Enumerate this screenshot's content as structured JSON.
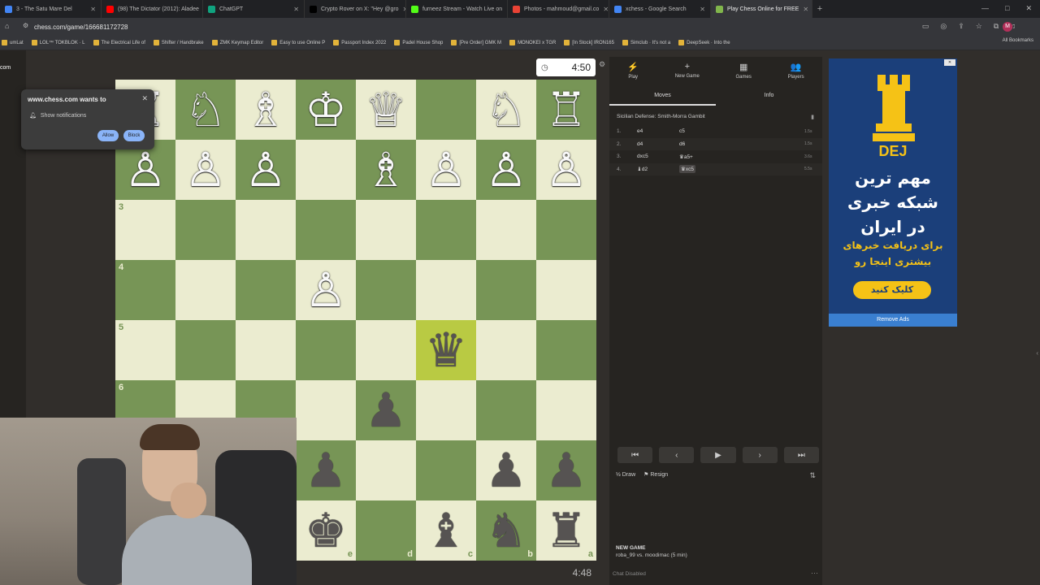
{
  "browser": {
    "tabs": [
      {
        "title": "3 - The Satu Mare Del",
        "color": "#4285f4",
        "active": false
      },
      {
        "title": "(98) The Dictator (2012): Aladee",
        "color": "#ff0000",
        "active": false
      },
      {
        "title": "ChatGPT",
        "color": "#10a37f",
        "active": false
      },
      {
        "title": "Crypto Rover on X: \"Hey @gro",
        "color": "#000000",
        "active": false
      },
      {
        "title": "furneez Stream - Watch Live on",
        "color": "#53fc18",
        "active": false
      },
      {
        "title": "Photos - mahmoud@gmail.co",
        "color": "#ea4335",
        "active": false
      },
      {
        "title": "xchess - Google Search",
        "color": "#4285f4",
        "active": false
      },
      {
        "title": "Play Chess Online for FREE",
        "color": "#81b64c",
        "active": true
      }
    ],
    "new_tab": "+",
    "url": "chess.com/game/166681172728",
    "avatar_letter": "M",
    "bookmarks": [
      "umLat",
      "LOL™ TOKBLOK · L",
      "The Electrical Life of",
      "Shifter / Handbrake",
      "ZMK Keymap Editor",
      "Easy to use Online P",
      "Passport Index 2022",
      "Padel House Shop",
      "[Pre Order] GMK M",
      "MONOKEI x TGR",
      "[In Stock] IRON165",
      "Simclub · It's not a",
      "DeepSeek · Into the"
    ],
    "all_bookmarks": "All Bookmarks"
  },
  "notification": {
    "title": "www.chess.com wants to",
    "line": "Show notifications",
    "allow": "Allow",
    "block": "Block"
  },
  "leftnav": {
    "label": "com"
  },
  "clock_top": "4:50",
  "clock_bottom": "4:48",
  "board": {
    "orientation": "black-bottom",
    "ranks": [
      "1",
      "2",
      "3",
      "4",
      "5",
      "6",
      "7",
      "8"
    ],
    "files": [
      "h",
      "g",
      "f",
      "e",
      "d",
      "c",
      "b",
      "a"
    ],
    "highlight": [
      "c5"
    ],
    "rows": [
      [
        "wR",
        "wN",
        "wB",
        "wK",
        "wQ",
        "",
        "wN",
        "wR"
      ],
      [
        "wP",
        "wP",
        "wP",
        "",
        "wB",
        "wP",
        "wP",
        "wP"
      ],
      [
        "",
        "",
        "",
        "",
        "",
        "",
        "",
        ""
      ],
      [
        "",
        "",
        "",
        "wP",
        "",
        "",
        "",
        ""
      ],
      [
        "",
        "",
        "",
        "",
        "",
        "bQ",
        "",
        ""
      ],
      [
        "",
        "",
        "",
        "",
        "bP",
        "",
        "",
        ""
      ],
      [
        "",
        "",
        "",
        "bP",
        "",
        "",
        "bP",
        "bP"
      ],
      [
        "",
        "",
        "",
        "bK",
        "",
        "bB",
        "bN",
        "bR"
      ]
    ],
    "visible_rank_labels": [
      "",
      "2",
      "3",
      "4",
      "5",
      "6",
      "",
      ""
    ],
    "visible_file_labels": [
      "",
      "",
      "",
      "e",
      "d",
      "c",
      "b",
      "a"
    ]
  },
  "panel": {
    "tabs": [
      {
        "label": "Play",
        "icon": "⚡"
      },
      {
        "label": "New Game",
        "icon": "+"
      },
      {
        "label": "Games",
        "icon": "▦"
      },
      {
        "label": "Players",
        "icon": "👥"
      }
    ],
    "subtabs": [
      "Moves",
      "Info"
    ],
    "opening": "Sicilian Defense: Smith-Morra Gambit",
    "moves": [
      {
        "n": "1.",
        "w": "e4",
        "b": "c5",
        "t": "1.5s"
      },
      {
        "n": "2.",
        "w": "d4",
        "b": "d6",
        "t": "1.5s"
      },
      {
        "n": "3.",
        "w": "dxc5",
        "b": "♛a5+",
        "t": "3.6s"
      },
      {
        "n": "4.",
        "w": "♝d2",
        "b": "♛xc5",
        "t": "5.5s"
      }
    ],
    "controls": [
      "⏮",
      "‹",
      "▶",
      "›",
      "⏭"
    ],
    "draw": "Draw",
    "resign": "Resign",
    "new_game_title": "NEW GAME",
    "new_game_sub": "roba_99 vs. moodimac (5 min)"
  },
  "chat": "Chat Disabled",
  "ad": {
    "brand": "DEJ",
    "headline": "مهم ترین شبکه خبری در ایران",
    "sub": "برای دریافت خبرهای بیشتری اینجا رو",
    "cta": "کلیک کنید",
    "remove": "Remove Ads",
    "close": "✕"
  },
  "colors": {
    "light": "#ebecd0",
    "dark": "#779556",
    "highlight": "#b9ca43",
    "ad_bg": "#1b3f7a",
    "ad_accent": "#f5c216"
  }
}
